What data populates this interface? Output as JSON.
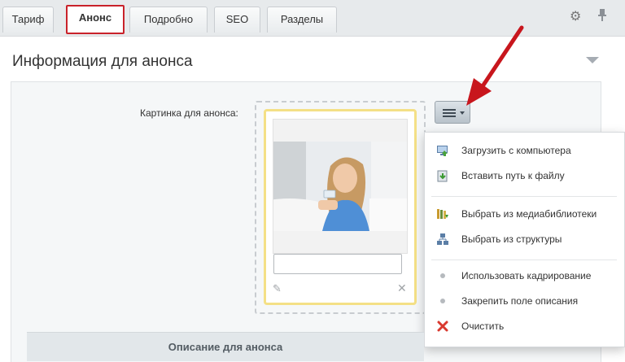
{
  "tabs": [
    {
      "label": "Тариф",
      "active": false
    },
    {
      "label": "Анонс",
      "active": true
    },
    {
      "label": "Подробно",
      "active": false
    },
    {
      "label": "SEO",
      "active": false
    },
    {
      "label": "Разделы",
      "active": false
    }
  ],
  "toolbar_icons": [
    "gear-icon",
    "pin-icon"
  ],
  "section": {
    "title": "Информация для анонса",
    "field_label": "Картинка для анонса:",
    "description_value": "",
    "footer_title": "Описание для анонса"
  },
  "menu": {
    "items": [
      {
        "label": "Загрузить с компьютера",
        "icon": "computer-upload-icon"
      },
      {
        "label": "Вставить путь к файлу",
        "icon": "file-path-icon"
      },
      {
        "label": "Выбрать из медиабиблиотеки",
        "icon": "media-library-icon"
      },
      {
        "label": "Выбрать из структуры",
        "icon": "structure-icon"
      },
      {
        "label": "Использовать кадрирование",
        "icon": "dot-icon"
      },
      {
        "label": "Закрепить поле описания",
        "icon": "dot-icon"
      },
      {
        "label": "Очистить",
        "icon": "clear-icon"
      }
    ]
  },
  "colors": {
    "active_tab_border": "#c9222a",
    "image_card_border": "#f4e086",
    "annotation_arrow": "#c8161d"
  }
}
